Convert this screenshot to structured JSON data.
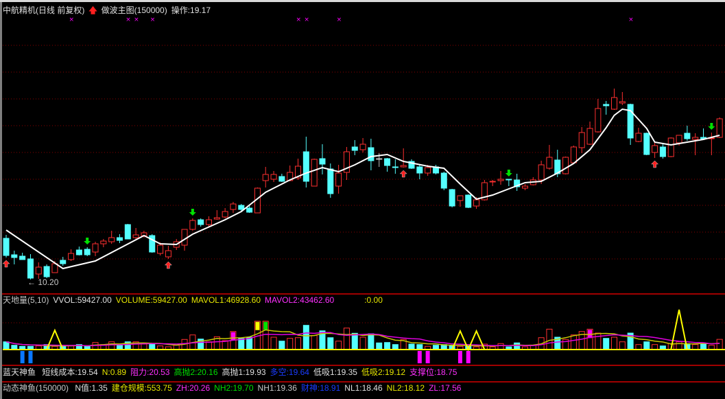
{
  "header": {
    "stock": "中航精机(日线 前复权)",
    "indicator": "做波主图(150000)",
    "operation": "操作:19.17",
    "arrow_icon": "red-up-arrow-icon"
  },
  "low_label": "← 10.20",
  "volume_header": {
    "name": "天地量(5,10)",
    "vvol": "VVOL:59427.00",
    "volume": "VOLUME:59427.00",
    "mavol1": "MAVOL1:46928.60",
    "mavol2": "MAVOL2:43462.60",
    "extra": ":0.00"
  },
  "fish1": {
    "name": "蓝天神鱼",
    "items": [
      {
        "text": "短线成本:19.54",
        "color": "w"
      },
      {
        "text": "N:0.89",
        "color": "y"
      },
      {
        "text": "阻力:20.53",
        "color": "m"
      },
      {
        "text": "高抛2:20.16",
        "color": "g"
      },
      {
        "text": "高抛1:19.93",
        "color": "w"
      },
      {
        "text": "多空:19.64",
        "color": "b"
      },
      {
        "text": "低吸1:19.35",
        "color": "w"
      },
      {
        "text": "低吸2:19.12",
        "color": "y"
      },
      {
        "text": "支撑位:18.75",
        "color": "m"
      }
    ]
  },
  "fish2": {
    "name": "动态神鱼(150000)",
    "items": [
      {
        "text": "N值:1.35",
        "color": "w"
      },
      {
        "text": "建仓规模:553.75",
        "color": "y"
      },
      {
        "text": "ZH:20.26",
        "color": "m"
      },
      {
        "text": "NH2:19.70",
        "color": "g"
      },
      {
        "text": "NH1:19.36",
        "color": "gr"
      },
      {
        "text": "财神:18.91",
        "color": "b"
      },
      {
        "text": "NL1:18.46",
        "color": "w"
      },
      {
        "text": "NL2:18.12",
        "color": "y"
      },
      {
        "text": "ZL:17.56",
        "color": "m"
      }
    ]
  },
  "colors": {
    "up": "#ff3030",
    "down": "#54ffff",
    "doji": "#c0c0c0",
    "ma": "#ffffff",
    "grid": "#8b0000",
    "mavol1": "#c8c800",
    "mavol2": "#e000e0",
    "spike": "#ffff00",
    "buy": "#ff2020",
    "sell": "#00e000",
    "blue": "#0a78ff",
    "magenta": "#ff00ff"
  },
  "chart_data": {
    "type": "candlestick",
    "title": "中航精机(日线 前复权)",
    "ylim": [
      9.5,
      26.5
    ],
    "ohlc": [
      [
        12.6,
        12.8,
        11.48,
        11.6
      ],
      [
        11.64,
        11.88,
        11.08,
        11.48
      ],
      [
        11.56,
        11.76,
        11.36,
        11.36
      ],
      [
        11.4,
        11.68,
        10.2,
        10.28
      ],
      [
        10.52,
        11.2,
        10.24,
        10.92
      ],
      [
        10.96,
        11.08,
        10.28,
        10.36
      ],
      [
        10.6,
        11.28,
        10.6,
        11.12
      ],
      [
        11.32,
        11.52,
        11.0,
        11.12
      ],
      [
        11.36,
        11.96,
        11.28,
        11.72
      ],
      [
        11.92,
        12.12,
        11.6,
        11.64
      ],
      [
        11.96,
        12.08,
        11.56,
        11.64
      ],
      [
        11.8,
        12.4,
        11.56,
        12.28
      ],
      [
        12.28,
        12.56,
        12.08,
        12.44
      ],
      [
        12.4,
        13.04,
        12.28,
        12.64
      ],
      [
        12.64,
        12.84,
        12.32,
        12.48
      ],
      [
        13.4,
        13.44,
        12.56,
        12.56
      ],
      [
        12.64,
        13.2,
        12.56,
        12.8
      ],
      [
        12.76,
        13.04,
        12.64,
        12.92
      ],
      [
        12.76,
        12.84,
        11.76,
        11.8
      ],
      [
        11.72,
        12.36,
        11.6,
        12.2
      ],
      [
        11.52,
        12.16,
        11.4,
        11.88
      ],
      [
        12.08,
        12.56,
        11.92,
        12.4
      ],
      [
        12.2,
        13.12,
        11.88,
        13.12
      ],
      [
        13.12,
        13.76,
        13.04,
        13.64
      ],
      [
        13.68,
        13.76,
        13.28,
        13.4
      ],
      [
        13.4,
        13.88,
        13.28,
        13.68
      ],
      [
        13.72,
        14.24,
        13.68,
        13.8
      ],
      [
        13.84,
        14.36,
        13.76,
        14.16
      ],
      [
        14.28,
        14.72,
        14.08,
        14.6
      ],
      [
        14.52,
        14.6,
        14.2,
        14.28
      ],
      [
        14.36,
        14.48,
        14.08,
        14.12
      ],
      [
        14.08,
        15.56,
        14.08,
        15.52
      ],
      [
        15.96,
        16.76,
        15.56,
        16.32
      ],
      [
        16.04,
        16.52,
        15.88,
        16.32
      ],
      [
        16.2,
        16.36,
        15.88,
        15.92
      ],
      [
        15.96,
        16.84,
        15.92,
        16.44
      ],
      [
        16.12,
        17.24,
        16.0,
        16.8
      ],
      [
        17.64,
        18.52,
        15.56,
        15.92
      ],
      [
        15.64,
        17.24,
        15.64,
        17.2
      ],
      [
        17.24,
        18.08,
        16.32,
        16.92
      ],
      [
        16.64,
        16.96,
        14.96,
        15.2
      ],
      [
        15.64,
        16.88,
        15.2,
        16.4
      ],
      [
        16.44,
        17.92,
        16.0,
        17.64
      ],
      [
        17.92,
        18.32,
        17.44,
        17.72
      ],
      [
        17.76,
        18.44,
        17.6,
        18.08
      ],
      [
        17.88,
        18.4,
        16.56,
        17.12
      ],
      [
        17.24,
        17.56,
        16.76,
        17.24
      ],
      [
        17.24,
        17.28,
        16.48,
        16.84
      ],
      [
        16.76,
        17.2,
        16.36,
        16.72
      ],
      [
        16.76,
        17.84,
        16.72,
        16.84
      ],
      [
        17.08,
        17.2,
        16.64,
        16.68
      ],
      [
        16.76,
        16.88,
        16.04,
        16.4
      ],
      [
        16.4,
        16.88,
        16.24,
        16.72
      ],
      [
        16.76,
        16.88,
        16.32,
        16.4
      ],
      [
        16.4,
        16.48,
        15.4,
        15.52
      ],
      [
        15.44,
        15.48,
        14.4,
        14.48
      ],
      [
        14.8,
        15.08,
        14.44,
        15.08
      ],
      [
        15.12,
        15.16,
        14.36,
        14.4
      ],
      [
        14.48,
        15.0,
        14.32,
        14.84
      ],
      [
        14.84,
        16.0,
        14.8,
        15.84
      ],
      [
        15.88,
        16.0,
        15.64,
        15.92
      ],
      [
        15.96,
        16.52,
        15.72,
        16.04
      ],
      [
        16.04,
        16.04,
        15.64,
        16.0
      ],
      [
        16.0,
        16.36,
        15.36,
        15.6
      ],
      [
        15.52,
        15.76,
        15.4,
        15.64
      ],
      [
        15.72,
        16.16,
        15.68,
        16.0
      ],
      [
        16.0,
        17.12,
        15.76,
        16.88
      ],
      [
        16.68,
        18.04,
        16.6,
        17.32
      ],
      [
        17.16,
        17.76,
        16.16,
        16.36
      ],
      [
        16.36,
        17.36,
        16.32,
        17.32
      ],
      [
        17.0,
        18.0,
        16.96,
        17.92
      ],
      [
        17.88,
        19.08,
        17.56,
        18.76
      ],
      [
        18.08,
        19.4,
        18.04,
        19.0
      ],
      [
        18.8,
        20.72,
        18.76,
        20.16
      ],
      [
        20.4,
        20.6,
        19.8,
        20.32
      ],
      [
        20.12,
        21.32,
        20.08,
        20.8
      ],
      [
        20.48,
        21.12,
        20.36,
        20.56
      ],
      [
        20.4,
        20.44,
        18.04,
        18.44
      ],
      [
        18.24,
        19.04,
        18.2,
        18.72
      ],
      [
        18.72,
        18.76,
        17.44,
        17.48
      ],
      [
        17.6,
        18.24,
        17.28,
        18.0
      ],
      [
        17.92,
        18.08,
        17.24,
        17.36
      ],
      [
        17.36,
        18.48,
        17.32,
        18.44
      ],
      [
        18.16,
        18.6,
        18.0,
        18.6
      ],
      [
        18.72,
        19.16,
        18.28,
        18.4
      ],
      [
        18.36,
        18.72,
        17.44,
        18.48
      ],
      [
        18.48,
        19.0,
        18.36,
        18.4
      ],
      [
        18.4,
        18.76,
        17.44,
        18.44
      ],
      [
        18.48,
        19.64,
        18.44,
        19.56
      ]
    ],
    "ma_points": [
      [
        1,
        13.08
      ],
      [
        8,
        10.84
      ],
      [
        12,
        11.28
      ],
      [
        18,
        12.76
      ],
      [
        20,
        12.28
      ],
      [
        22,
        12.24
      ],
      [
        24,
        12.84
      ],
      [
        28,
        13.68
      ],
      [
        30,
        14.16
      ],
      [
        33,
        15.28
      ],
      [
        36,
        16.0
      ],
      [
        38,
        16.4
      ],
      [
        40,
        16.72
      ],
      [
        42,
        16.48
      ],
      [
        44,
        16.88
      ],
      [
        46,
        17.36
      ],
      [
        48,
        17.48
      ],
      [
        50,
        17.08
      ],
      [
        53,
        16.8
      ],
      [
        55,
        16.68
      ],
      [
        57,
        15.76
      ],
      [
        59,
        14.88
      ],
      [
        61,
        15.12
      ],
      [
        63,
        15.48
      ],
      [
        65,
        15.84
      ],
      [
        67,
        15.92
      ],
      [
        69,
        16.4
      ],
      [
        71,
        16.96
      ],
      [
        73,
        17.76
      ],
      [
        75,
        19.04
      ],
      [
        76,
        19.76
      ],
      [
        77,
        20.12
      ],
      [
        78,
        20.04
      ],
      [
        80,
        19.0
      ],
      [
        81,
        18.2
      ],
      [
        83,
        18.04
      ],
      [
        85,
        18.2
      ],
      [
        87,
        18.36
      ],
      [
        89,
        18.6
      ]
    ],
    "buy_signals": [
      1,
      21,
      50,
      81
    ],
    "sell_signals": [
      11,
      24,
      63,
      88
    ],
    "top_markers": [
      9,
      16,
      17,
      19,
      37,
      38,
      42,
      78
    ],
    "doji": [
      47
    ],
    "low_mark": {
      "index": 4,
      "value": 10.2
    },
    "volume": [
      45200,
      25200,
      18800,
      18800,
      21200,
      29200,
      18800,
      18800,
      21200,
      29200,
      21200,
      41200,
      29200,
      45200,
      25200,
      45200,
      45200,
      32000,
      34800,
      21200,
      16000,
      25200,
      58800,
      85200,
      61200,
      45200,
      74800,
      52000,
      105200,
      65200,
      72000,
      165200,
      165200,
      72000,
      49200,
      65200,
      69200,
      141200,
      82800,
      109200,
      69200,
      49200,
      125200,
      94800,
      72000,
      92000,
      38800,
      41200,
      29200,
      58800,
      32000,
      29200,
      18800,
      25200,
      29200,
      25200,
      18800,
      18800,
      16000,
      32000,
      16000,
      34800,
      16000,
      38800,
      16000,
      25200,
      69200,
      118800,
      72000,
      58800,
      85200,
      105200,
      118800,
      96000,
      65200,
      72000,
      45200,
      96000,
      29200,
      45200,
      29200,
      21200,
      34800,
      45200,
      34800,
      29200,
      34800,
      25200,
      59427
    ],
    "volume_highlights": [
      {
        "index": 29,
        "color": "magenta"
      },
      {
        "index": 32,
        "color": "yellow"
      },
      {
        "index": 33,
        "color": "green"
      },
      {
        "index": 73,
        "color": "magenta"
      }
    ],
    "spikes": [
      {
        "index": 7,
        "value": 112000
      },
      {
        "index": 57,
        "value": 108000
      },
      {
        "index": 59,
        "value": 108000
      },
      {
        "index": 84,
        "value": 232000
      }
    ],
    "blue_bars": [
      3,
      4
    ],
    "magenta_bars": [
      52,
      53,
      57,
      58
    ]
  }
}
